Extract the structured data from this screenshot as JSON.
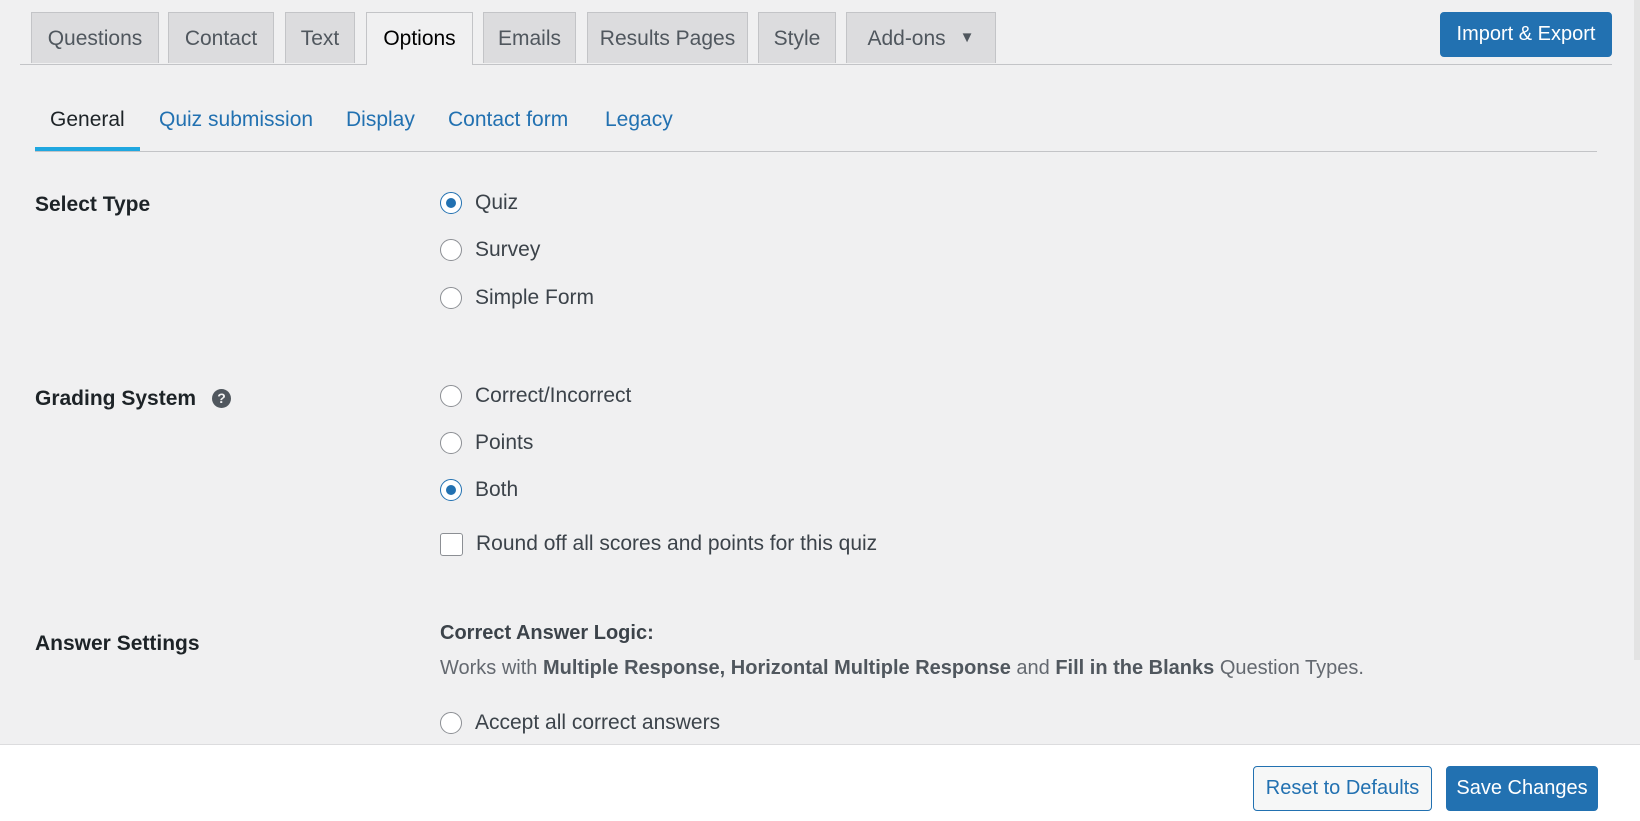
{
  "top_tabs": [
    {
      "label": "Questions"
    },
    {
      "label": "Contact"
    },
    {
      "label": "Text"
    },
    {
      "label": "Options",
      "active": true
    },
    {
      "label": "Emails"
    },
    {
      "label": "Results Pages"
    },
    {
      "label": "Style"
    },
    {
      "label": "Add-ons",
      "has_dropdown": true
    }
  ],
  "dropdown_caret": "▼",
  "import_export_label": "Import & Export",
  "sub_tabs": [
    {
      "label": "General",
      "active": true
    },
    {
      "label": "Quiz submission"
    },
    {
      "label": "Display"
    },
    {
      "label": "Contact form"
    },
    {
      "label": "Legacy"
    }
  ],
  "select_type": {
    "label": "Select Type",
    "options": [
      {
        "label": "Quiz",
        "checked": true
      },
      {
        "label": "Survey",
        "checked": false
      },
      {
        "label": "Simple Form",
        "checked": false
      }
    ]
  },
  "grading_system": {
    "label": "Grading System",
    "help_icon": "?",
    "options": [
      {
        "label": "Correct/Incorrect",
        "checked": false
      },
      {
        "label": "Points",
        "checked": false
      },
      {
        "label": "Both",
        "checked": true
      }
    ],
    "round_off_label": "Round off all scores and points for this quiz",
    "round_off_checked": false
  },
  "answer_settings": {
    "label": "Answer Settings",
    "heading": "Correct Answer Logic:",
    "description_prefix": "Works with",
    "type_1": "Multiple Response,",
    "type_2": "Horizontal Multiple Response",
    "description_and": "and",
    "type_3": "Fill in the Blanks",
    "description_suffix": "Question Types.",
    "options": [
      {
        "label": "Accept all correct answers",
        "checked": false
      }
    ]
  },
  "footer": {
    "reset_label": "Reset to Defaults",
    "save_label": "Save Changes"
  },
  "colors": {
    "primary": "#2271b1",
    "active_tab_underline": "#1fa7e0",
    "background": "#f0f0f1"
  }
}
